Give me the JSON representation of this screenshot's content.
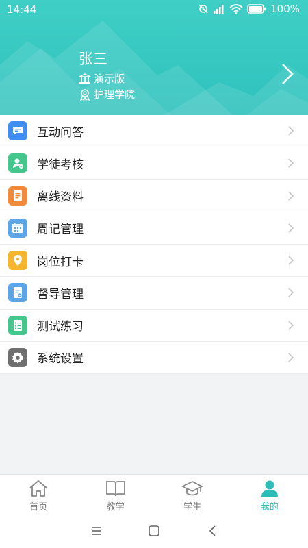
{
  "status": {
    "time": "14:44",
    "battery": "100%"
  },
  "profile": {
    "name": "张三",
    "edition": "演示版",
    "college": "护理学院"
  },
  "colors": {
    "header": "#38c9c1",
    "accent": "#2bbdb6"
  },
  "menu": [
    {
      "label": "互动问答",
      "icon": "chat-bubble-icon",
      "color": "#3f8ef0"
    },
    {
      "label": "学徒考核",
      "icon": "user-check-icon",
      "color": "#43c78c"
    },
    {
      "label": "离线资料",
      "icon": "document-icon",
      "color": "#f28a3c"
    },
    {
      "label": "周记管理",
      "icon": "calendar-icon",
      "color": "#5aa6e8"
    },
    {
      "label": "岗位打卡",
      "icon": "location-pin-icon",
      "color": "#f5b52c"
    },
    {
      "label": "督导管理",
      "icon": "clipboard-icon",
      "color": "#5aa6e8"
    },
    {
      "label": "测试练习",
      "icon": "checklist-icon",
      "color": "#43c78c"
    },
    {
      "label": "系统设置",
      "icon": "gear-icon",
      "color": "#6f6f6f"
    }
  ],
  "nav": [
    {
      "label": "首页",
      "icon": "home-icon"
    },
    {
      "label": "教学",
      "icon": "book-icon"
    },
    {
      "label": "学生",
      "icon": "graduation-cap-icon"
    },
    {
      "label": "我的",
      "icon": "person-icon",
      "active": true
    }
  ]
}
